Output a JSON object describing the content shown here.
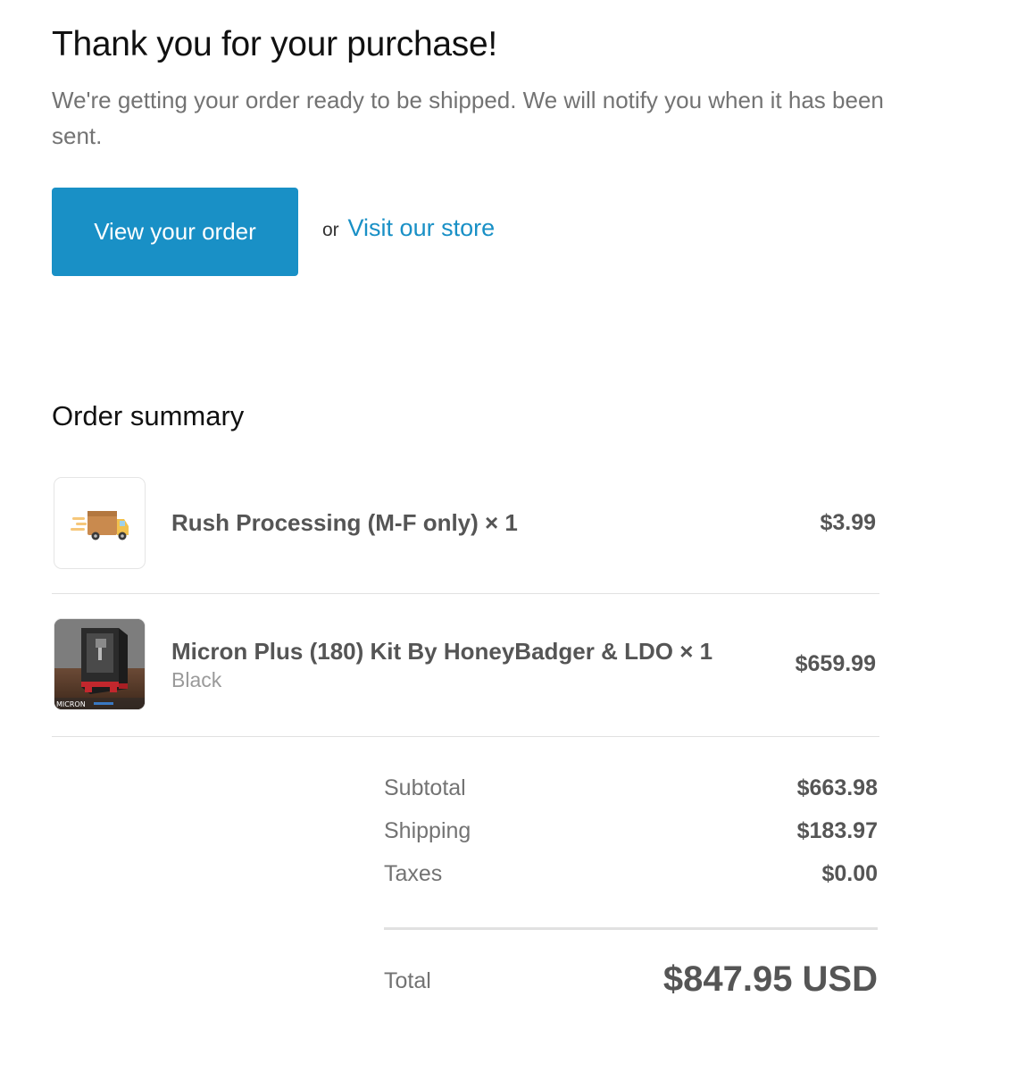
{
  "header": {
    "title": "Thank you for your purchase!",
    "message": "We're getting your order ready to be shipped. We will notify you when it has been sent."
  },
  "actions": {
    "view_order_label": "View your order",
    "or_text": "or",
    "visit_store_label": "Visit our store"
  },
  "summary": {
    "title": "Order summary",
    "items": [
      {
        "name": "Rush Processing (M-F only) × 1",
        "price": "$3.99",
        "icon": "delivery-truck-icon"
      },
      {
        "name": "Micron Plus (180) Kit By HoneyBadger & LDO × 1",
        "variant": "Black",
        "price": "$659.99",
        "image_caption": "MICRON"
      }
    ],
    "subtotal_label": "Subtotal",
    "subtotal": "$663.98",
    "shipping_label": "Shipping",
    "shipping": "$183.97",
    "taxes_label": "Taxes",
    "taxes": "$0.00",
    "total_label": "Total",
    "total": "$847.95 USD"
  },
  "colors": {
    "accent": "#1990c6",
    "heading": "#111111",
    "muted_text": "#737373",
    "value_text": "#555555",
    "divider": "#e1e1e1"
  }
}
